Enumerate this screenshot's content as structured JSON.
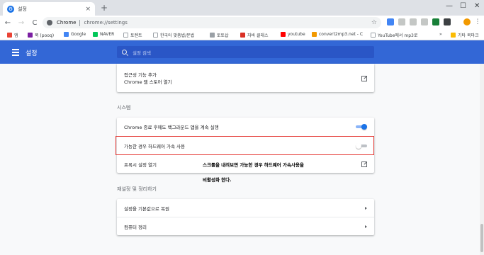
{
  "window": {
    "tab_title": "설정",
    "tab_close": "×",
    "new_tab": "+",
    "controls": [
      "—",
      "☐",
      "✕"
    ]
  },
  "toolbar": {
    "back": "←",
    "forward": "→",
    "reload": "C",
    "site_chip": "Chrome",
    "url": "chrome://settings",
    "star": "☆",
    "menu": "⋮",
    "extensions": [
      {
        "name": "ext-1",
        "color": "#4285f4",
        "label": "4"
      },
      {
        "name": "ext-2",
        "color": "#c4c7c5",
        "label": ""
      },
      {
        "name": "ext-3",
        "color": "#c4c7c5",
        "label": ""
      },
      {
        "name": "ext-4",
        "color": "#c4c7c5",
        "label": ""
      },
      {
        "name": "ext-5",
        "color": "#188038",
        "label": ""
      },
      {
        "name": "ext-6",
        "color": "#3c4043",
        "label": ""
      },
      {
        "name": "ext-7",
        "color": "#ffffff",
        "label": ""
      },
      {
        "name": "profile",
        "color": "#f29900",
        "label": ""
      }
    ]
  },
  "bookmarks": [
    {
      "label": "앱",
      "color": "#ea4335"
    },
    {
      "label": "푹 (pooq)",
      "color": "#7b1fa2"
    },
    {
      "label": "Google",
      "color": "#4285f4"
    },
    {
      "label": "NAVER",
      "color": "#03c75a"
    },
    {
      "label": "토렌트",
      "color": "#ffffff"
    },
    {
      "label": "한국어 맞춤법/문법",
      "color": "#ffffff"
    },
    {
      "label": "토토삽",
      "color": "#9aa0a6"
    },
    {
      "label": "자바 클래스",
      "color": "#d93025"
    },
    {
      "label": "youtube",
      "color": "#ff0000"
    },
    {
      "label": "convert2mp3.net - C",
      "color": "#f29900"
    },
    {
      "label": "YouTube에서 mp3로",
      "color": "#ffffff"
    },
    {
      "label": "»",
      "color": ""
    },
    {
      "label": "기타 북마크",
      "color": "#fbbc04"
    }
  ],
  "header": {
    "title": "설정",
    "search_placeholder": "설정 검색"
  },
  "accessibility_card": {
    "title": "접근성 기능 추가",
    "subtitle": "Chrome 웹 스토어 열기"
  },
  "system": {
    "section_title": "시스템",
    "rows": [
      {
        "label": "Chrome 종료 후에도 백그라운드 앱을 계속 실행",
        "enabled": true
      },
      {
        "label": "가능한 경우 하드웨어 가속 사용",
        "enabled": false
      },
      {
        "label": "프록시 설정 열기"
      }
    ]
  },
  "reset": {
    "section_title": "재설정 및 정리하기",
    "rows": [
      {
        "label": "설정을 기본값으로 복원"
      },
      {
        "label": "컴퓨터 정리"
      }
    ]
  },
  "annotation": {
    "line1": "스크롤을 내려보면 가능한 경우 하드웨어 가속사용을",
    "line2": "비활성화 한다."
  },
  "colors": {
    "header_blue": "#3367d6",
    "highlight_red": "#e53935",
    "toggle_on": "#1a73e8"
  }
}
